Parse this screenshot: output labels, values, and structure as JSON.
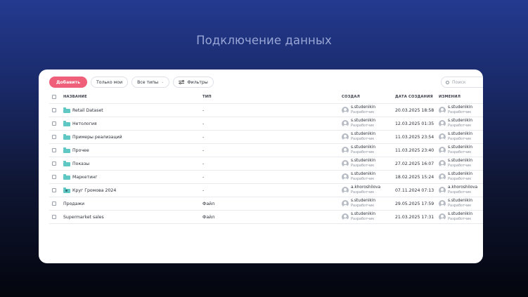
{
  "hero": {
    "title": "Подключение данных"
  },
  "toolbar": {
    "add_label": "Добавить",
    "only_mine_label": "Только мои",
    "all_types_label": "Все типы",
    "filters_label": "Фильтры",
    "chevron": "⌄"
  },
  "search": {
    "placeholder": "Поиск"
  },
  "columns": {
    "name": "НАЗВАНИЕ",
    "type": "ТИП",
    "creator": "СОЗДАЛ",
    "created": "ДАТА СОЗДАНИЯ",
    "modified": "ИЗМЕНИЛ"
  },
  "rows": [
    {
      "name": "Retail Dataset",
      "icon": "folder-icon",
      "type": "-",
      "creator": "s.studenikin",
      "creator_role": "Разработчик",
      "date": "20.03.2025 18:58",
      "modifier": "s.studenikin",
      "modifier_role": "Разработчик"
    },
    {
      "name": "Нетология",
      "icon": "folder-icon",
      "type": "-",
      "creator": "s.studenikin",
      "creator_role": "Разработчик",
      "date": "12.03.2025 01:35",
      "modifier": "s.studenikin",
      "modifier_role": "Разработчик"
    },
    {
      "name": "Примеры реализаций",
      "icon": "folder-icon",
      "type": "-",
      "creator": "s.studenikin",
      "creator_role": "Разработчик",
      "date": "11.03.2025 23:54",
      "modifier": "s.studenikin",
      "modifier_role": "Разработчик"
    },
    {
      "name": "Прочее",
      "icon": "folder-icon",
      "type": "-",
      "creator": "s.studenikin",
      "creator_role": "Разработчик",
      "date": "11.03.2025 23:40",
      "modifier": "s.studenikin",
      "modifier_role": "Разработчик"
    },
    {
      "name": "Показы",
      "icon": "folder-icon",
      "type": "-",
      "creator": "s.studenikin",
      "creator_role": "Разработчик",
      "date": "27.02.2025 16:07",
      "modifier": "s.studenikin",
      "modifier_role": "Разработчик"
    },
    {
      "name": "Маркетинг",
      "icon": "folder-icon",
      "type": "-",
      "creator": "s.studenikin",
      "creator_role": "Разработчик",
      "date": "18.02.2025 15:24",
      "modifier": "s.studenikin",
      "modifier_role": "Разработчик"
    },
    {
      "name": "Круг Громова 2024",
      "icon": "shared-folder-icon",
      "type": "-",
      "creator": "a.khoroshilova",
      "creator_role": "Разработчик",
      "date": "07.11.2024 07:13",
      "modifier": "a.khoroshilova",
      "modifier_role": "Разработчик"
    },
    {
      "name": "Продажи",
      "icon": "",
      "type": "Файл",
      "creator": "s.studenikin",
      "creator_role": "Разработчик",
      "date": "29.05.2025 17:59",
      "modifier": "s.studenikin",
      "modifier_role": "Разработчик"
    },
    {
      "name": "Supermarket sales",
      "icon": "",
      "type": "Файл",
      "creator": "s.studenikin",
      "creator_role": "Разработчик",
      "date": "21.03.2025 17:31",
      "modifier": "s.studenikin",
      "modifier_role": "Разработчик"
    }
  ],
  "colors": {
    "accent": "#ef5f7a",
    "folder": "#5fc7c4"
  }
}
